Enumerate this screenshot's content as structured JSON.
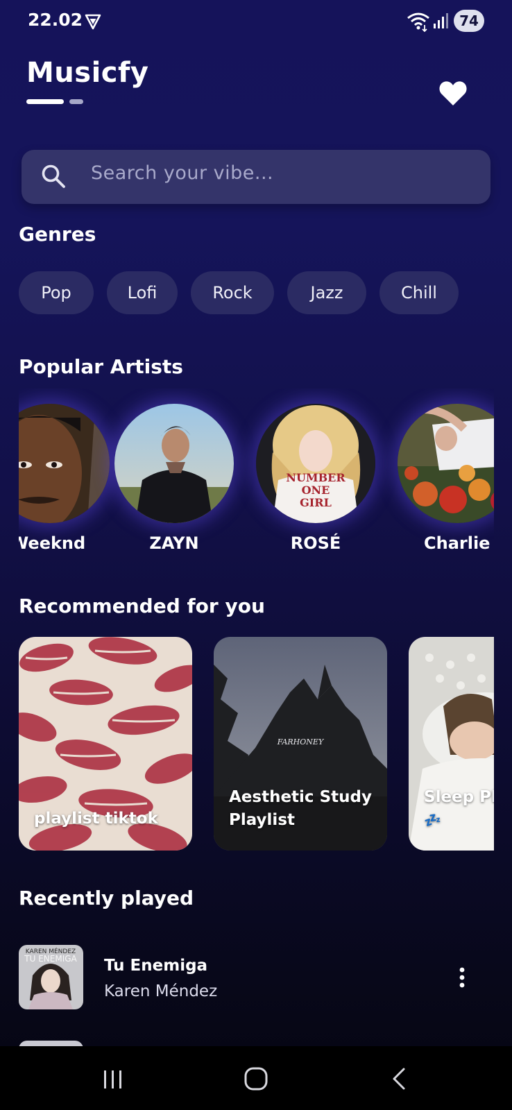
{
  "status_bar": {
    "time": "22.02",
    "battery": "74"
  },
  "header": {
    "title": "Musicfy"
  },
  "search": {
    "placeholder": "Search your vibe..."
  },
  "genres": {
    "title": "Genres",
    "items": [
      "Pop",
      "Lofi",
      "Rock",
      "Jazz",
      "Chill"
    ]
  },
  "artists": {
    "title": "Popular Artists",
    "items": [
      {
        "name": "Weeknd"
      },
      {
        "name": "ZAYN"
      },
      {
        "name": "ROSÉ",
        "shirt_lines": [
          "NUMBER",
          "ONE",
          "GIRL"
        ]
      },
      {
        "name": "Charlie Put"
      }
    ]
  },
  "recommended": {
    "title": "Recommended for you",
    "items": [
      {
        "label": "playlist tiktok"
      },
      {
        "label_line1": "Aesthetic Study",
        "label_line2": "Playlist",
        "watermark": "FARHONEY"
      },
      {
        "label": "Sleep Pla",
        "emoji": "💤"
      }
    ]
  },
  "recent": {
    "title": "Recently played",
    "items": [
      {
        "title": "Tu Enemiga",
        "artist": "Karen Méndez",
        "cover_line1": "KAREN MÉNDEZ",
        "cover_line2": "TU ENEMIGA"
      }
    ]
  },
  "colors": {
    "background_top": "#15135a",
    "background_bottom": "#050510",
    "search_bg": "#34346a",
    "chip_bg": "#2b2b63",
    "artist_glow": "#5a46dc"
  },
  "icons": [
    "vpn-icon",
    "wifi-icon",
    "signal-icon",
    "heart-icon",
    "search-icon",
    "more-icon",
    "nav-recents-icon",
    "nav-home-icon",
    "nav-back-icon"
  ]
}
